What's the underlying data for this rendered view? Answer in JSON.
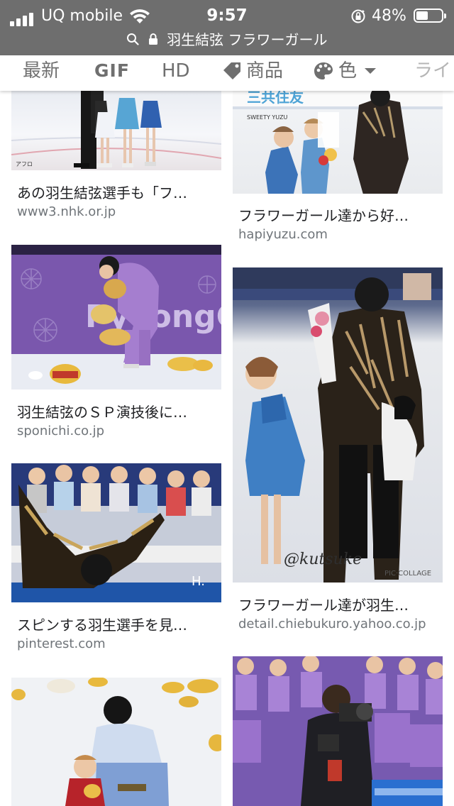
{
  "status_bar": {
    "carrier": "UQ mobile",
    "time": "9:57",
    "battery_percent": "48%",
    "battery_level": 0.48
  },
  "url_bar": {
    "query": "羽生結弦 フラワーガール"
  },
  "filters": {
    "latest": "最新",
    "gif": "GIF",
    "hd": "HD",
    "product": "商品",
    "color": "色",
    "more": "ライ"
  },
  "results": [
    {
      "caption": "あの羽生結弦選手も「フ…",
      "source": "www3.nhk.or.jp",
      "watermark": "アフロ"
    },
    {
      "caption": "フラワーガール達から好…",
      "source": "hapiyuzu.com",
      "watermark": "SWEETY YUZU"
    },
    {
      "caption": "羽生結弦のＳＰ演技後に…",
      "source": "sponichi.co.jp",
      "watermark": "PyeongCh"
    },
    {
      "caption": "フラワーガール達が羽生…",
      "source": "detail.chiebukuro.yahoo.co.jp",
      "watermark": "@kutsuke",
      "watermark2": "PIC·COLLAGE"
    },
    {
      "caption": "スピンする羽生選手を見…",
      "source": "pinterest.com",
      "watermark": "H."
    },
    {
      "caption": "",
      "source": ""
    },
    {
      "caption": "",
      "source": ""
    }
  ],
  "colors": {
    "status_bg": "#6e6e6e",
    "chip_text": "#6f6f6f",
    "caption_text": "#202124",
    "source_text": "#70757a"
  }
}
